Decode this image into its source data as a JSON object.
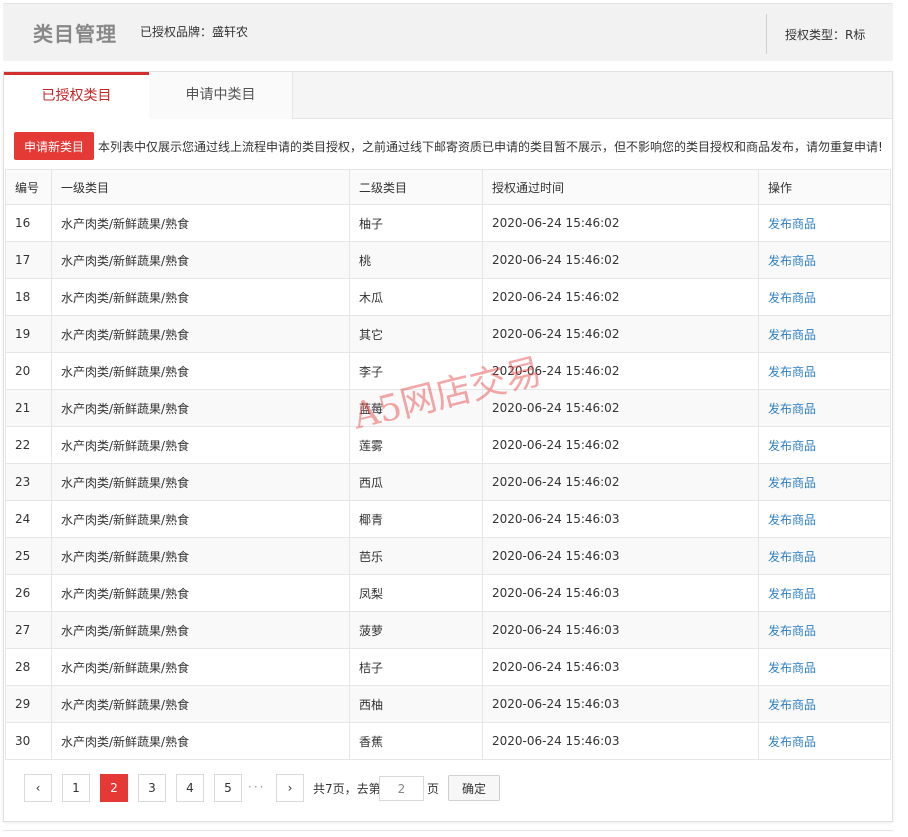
{
  "header": {
    "title": "类目管理",
    "brand": "已授权品牌：盛轩农",
    "auth_type": "授权类型：R标"
  },
  "tabs": [
    {
      "label": "已授权类目",
      "active": true
    },
    {
      "label": "申请中类目",
      "active": false
    }
  ],
  "notice": {
    "apply_button": "申请新类目",
    "text": "本列表中仅展示您通过线上流程申请的类目授权，之前通过线下邮寄资质已申请的类目暂不展示，但不影响您的类目授权和商品发布，请勿重复申请!"
  },
  "table": {
    "headers": [
      "编号",
      "一级类目",
      "二级类目",
      "授权通过时间",
      "操作"
    ],
    "rows": [
      {
        "id": "16",
        "level1": "水产肉类/新鲜蔬果/熟食",
        "level2": "柚子",
        "time": "2020-06-24 15:46:02",
        "action": "发布商品"
      },
      {
        "id": "17",
        "level1": "水产肉类/新鲜蔬果/熟食",
        "level2": "桃",
        "time": "2020-06-24 15:46:02",
        "action": "发布商品"
      },
      {
        "id": "18",
        "level1": "水产肉类/新鲜蔬果/熟食",
        "level2": "木瓜",
        "time": "2020-06-24 15:46:02",
        "action": "发布商品"
      },
      {
        "id": "19",
        "level1": "水产肉类/新鲜蔬果/熟食",
        "level2": "其它",
        "time": "2020-06-24 15:46:02",
        "action": "发布商品"
      },
      {
        "id": "20",
        "level1": "水产肉类/新鲜蔬果/熟食",
        "level2": "李子",
        "time": "2020-06-24 15:46:02",
        "action": "发布商品"
      },
      {
        "id": "21",
        "level1": "水产肉类/新鲜蔬果/熟食",
        "level2": "蓝莓",
        "time": "2020-06-24 15:46:02",
        "action": "发布商品"
      },
      {
        "id": "22",
        "level1": "水产肉类/新鲜蔬果/熟食",
        "level2": "莲雾",
        "time": "2020-06-24 15:46:02",
        "action": "发布商品"
      },
      {
        "id": "23",
        "level1": "水产肉类/新鲜蔬果/熟食",
        "level2": "西瓜",
        "time": "2020-06-24 15:46:02",
        "action": "发布商品"
      },
      {
        "id": "24",
        "level1": "水产肉类/新鲜蔬果/熟食",
        "level2": "椰青",
        "time": "2020-06-24 15:46:03",
        "action": "发布商品"
      },
      {
        "id": "25",
        "level1": "水产肉类/新鲜蔬果/熟食",
        "level2": "芭乐",
        "time": "2020-06-24 15:46:03",
        "action": "发布商品"
      },
      {
        "id": "26",
        "level1": "水产肉类/新鲜蔬果/熟食",
        "level2": "凤梨",
        "time": "2020-06-24 15:46:03",
        "action": "发布商品"
      },
      {
        "id": "27",
        "level1": "水产肉类/新鲜蔬果/熟食",
        "level2": "菠萝",
        "time": "2020-06-24 15:46:03",
        "action": "发布商品"
      },
      {
        "id": "28",
        "level1": "水产肉类/新鲜蔬果/熟食",
        "level2": "桔子",
        "time": "2020-06-24 15:46:03",
        "action": "发布商品"
      },
      {
        "id": "29",
        "level1": "水产肉类/新鲜蔬果/熟食",
        "level2": "西柚",
        "time": "2020-06-24 15:46:03",
        "action": "发布商品"
      },
      {
        "id": "30",
        "level1": "水产肉类/新鲜蔬果/熟食",
        "level2": "香蕉",
        "time": "2020-06-24 15:46:03",
        "action": "发布商品"
      }
    ]
  },
  "pagination": {
    "prev_icon": "‹",
    "next_icon": "›",
    "pages": [
      "1",
      "2",
      "3",
      "4",
      "5"
    ],
    "current": "2",
    "ellipsis": "···",
    "total_text": "共7页，去第",
    "goto_value": "2",
    "page_suffix": "页",
    "confirm": "确定"
  },
  "watermark": "A5网店交易",
  "colors": {
    "accent": "#e53935",
    "link": "#2f7fc1"
  }
}
